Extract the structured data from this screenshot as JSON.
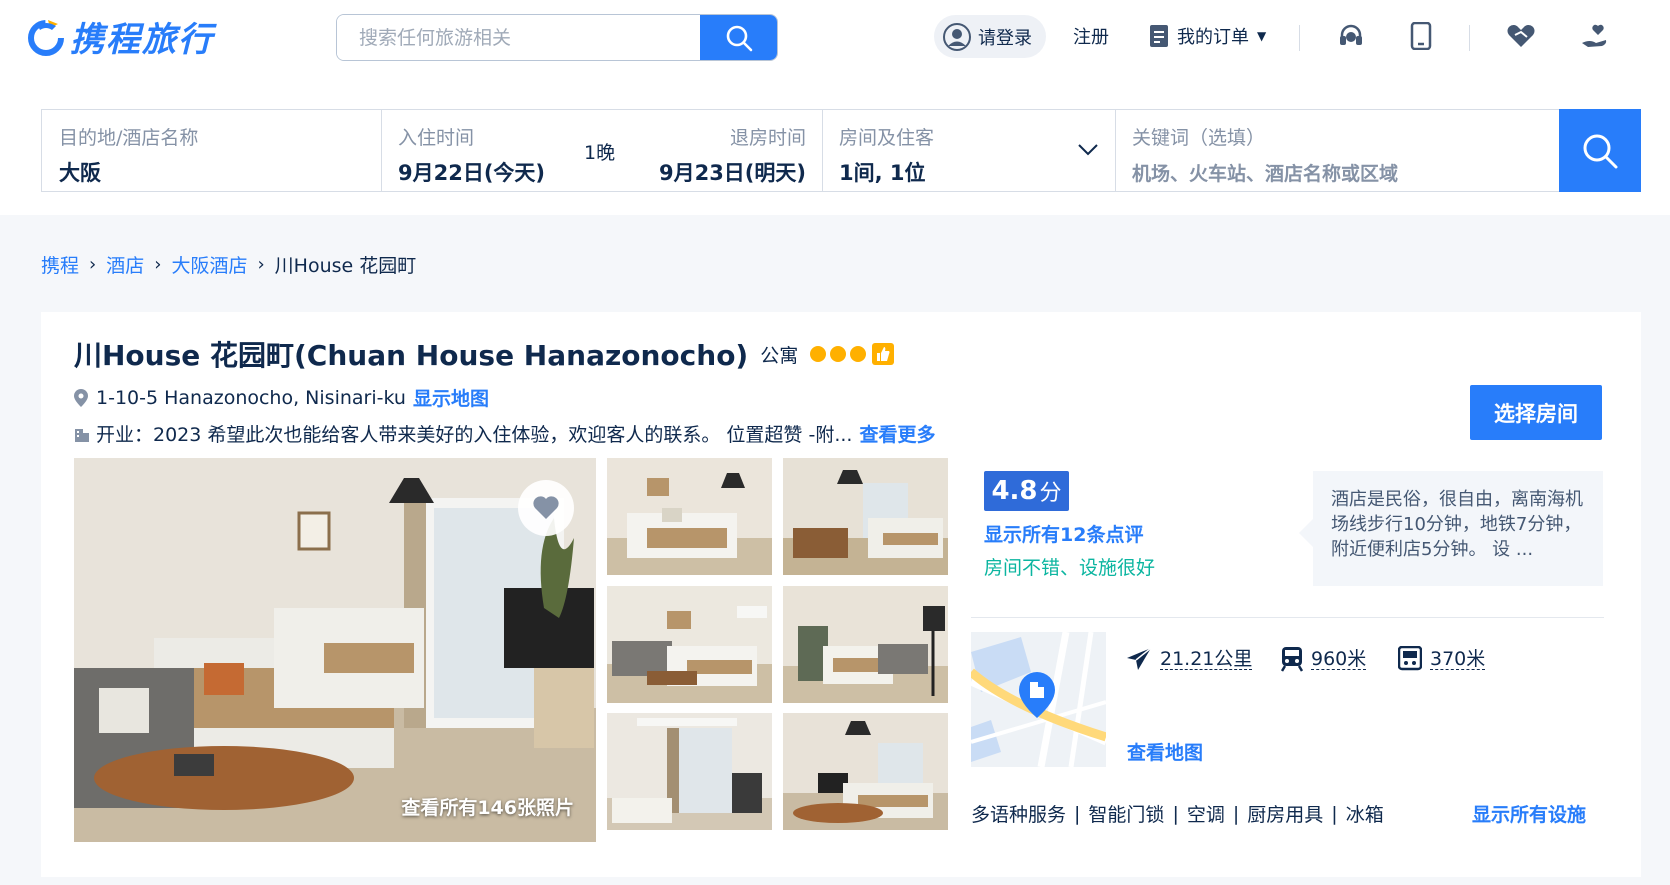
{
  "header": {
    "brand": "携程旅行",
    "search_placeholder": "搜索任何旅游相关",
    "login_label": "请登录",
    "register_label": "注册",
    "orders_label": "我的订单",
    "icons": [
      "headset-icon",
      "phone-icon",
      "handshake-icon",
      "hand-heart-icon"
    ]
  },
  "booking": {
    "destination_label": "目的地/酒店名称",
    "destination_value": "大阪",
    "checkin_label": "入住时间",
    "checkin_value": "9月22日(今天)",
    "nights": "1晚",
    "checkout_label": "退房时间",
    "checkout_value": "9月23日(明天)",
    "rooms_label": "房间及住客",
    "rooms_value": "1间, 1位",
    "keyword_label": "关键词（选填）",
    "keyword_placeholder": "机场、火车站、酒店名称或区域"
  },
  "breadcrumb": [
    "携程",
    "酒店",
    "大阪酒店",
    "川House 花园町"
  ],
  "hotel": {
    "name": "川House 花园町(Chuan House Hanazonocho)",
    "type": "公寓",
    "rating_dots": 3,
    "address": "1-10-5 Hanazonocho, Nisinari-ku",
    "show_map_link": "显示地图",
    "description": "开业：2023  希望此次也能给客人带来美好的入住体验，欢迎客人的联系。 位置超赞 -附...",
    "more_link": "查看更多",
    "select_room_button": "选择房间",
    "photos_caption": "查看所有146张照片"
  },
  "review": {
    "score": "4.8",
    "score_unit": "分",
    "all_reviews_link": "显示所有12条点评",
    "tag": "房间不错、设施很好",
    "quote": "酒店是民俗，很自由，离南海机场线步行10分钟，地铁7分钟，附近便利店5分钟。 设 ..."
  },
  "location": {
    "airport_distance": "21.21公里",
    "train_distance": "960米",
    "metro_distance": "370米",
    "view_map_link": "查看地图"
  },
  "facilities": {
    "items": [
      "多语种服务",
      "智能门锁",
      "空调",
      "厨房用具",
      "冰箱"
    ],
    "all_link": "显示所有设施"
  },
  "colors": {
    "accent": "#287dfa",
    "text": "#0f294d",
    "star": "#ffb000",
    "score_bg": "#2f6bd9",
    "tag_green": "#0bb5a0"
  }
}
